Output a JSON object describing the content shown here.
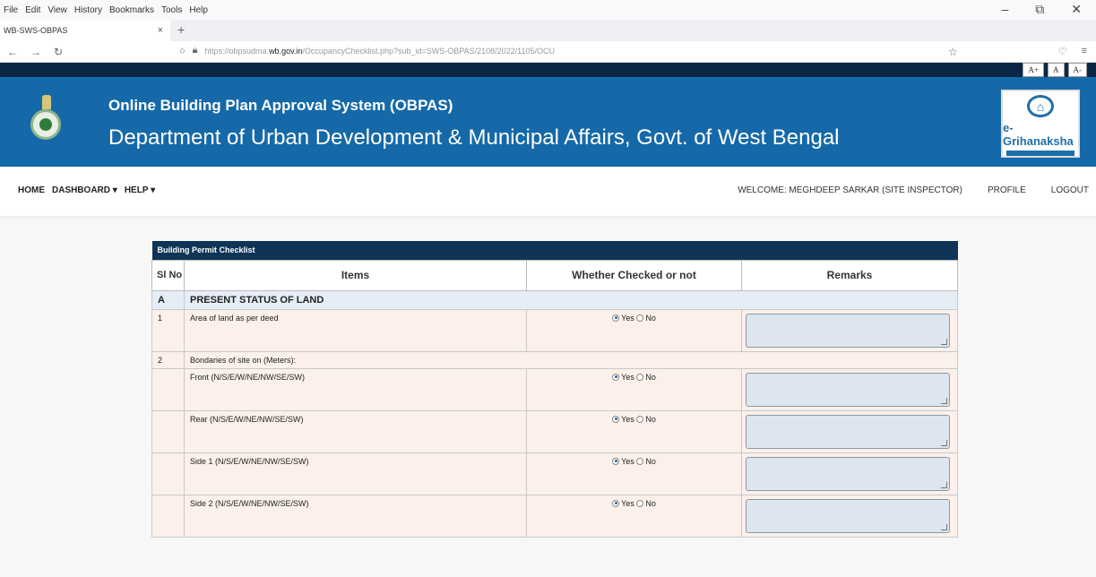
{
  "browser": {
    "menu": [
      "File",
      "Edit",
      "View",
      "History",
      "Bookmarks",
      "Tools",
      "Help"
    ],
    "tab_title": "WB-SWS-OBPAS",
    "url_prefix": "https://obpsudma.",
    "url_domain": "wb.gov.in",
    "url_rest": "/OccupancyChecklist.php?sub_id=SWS-OBPAS/2108/2022/1105/OCU"
  },
  "site": {
    "font_sizes": [
      "A+",
      "A",
      "A-"
    ],
    "title": "Online Building Plan Approval System (OBPAS)",
    "subtitle": "Department of Urban Development & Municipal Affairs, Govt. of West Bengal",
    "logo_text": "e-Grihanaksha"
  },
  "nav": {
    "home": "HOME",
    "dashboard": "DASHBOARD ▾",
    "help": "HELP ▾",
    "welcome": "WELCOME: MEGHDEEP SARKAR (SITE INSPECTOR)",
    "profile": "PROFILE",
    "logout": "LOGOUT"
  },
  "checklist": {
    "caption": "Building Permit Checklist",
    "headers": [
      "Sl No",
      "Items",
      "Whether Checked or not",
      "Remarks"
    ],
    "section_a": {
      "sl": "A",
      "label": "PRESENT STATUS OF LAND"
    },
    "row1": {
      "sl": "1",
      "item": "Area of land as per deed"
    },
    "row2": {
      "sl": "2",
      "item": "Bondaries of site on (Meters):"
    },
    "subs": [
      "Front (N/S/E/W/NE/NW/SE/SW)",
      "Rear (N/S/E/W/NE/NW/SE/SW)",
      "Side 1 (N/S/E/W/NE/NW/SE/SW)",
      "Side 2 (N/S/E/W/NE/NW/SE/SW)"
    ],
    "yes": "Yes",
    "no": "No"
  }
}
